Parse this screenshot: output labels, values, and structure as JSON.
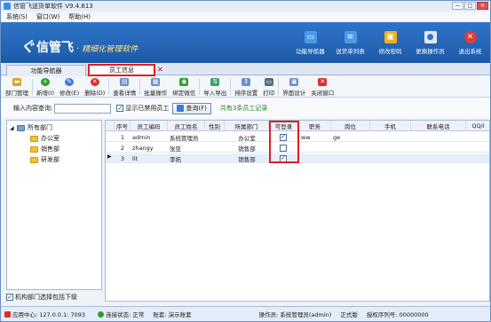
{
  "window": {
    "title": "信管飞送货单软件 V9.4.613",
    "buttons": {
      "min": "—",
      "max": "□",
      "close": "✕"
    }
  },
  "menu": [
    "系统(S)",
    "窗口(W)",
    "帮助(H)"
  ],
  "banner": {
    "brand": "信管飞",
    "slogan": "精细化管理软件",
    "nav": [
      {
        "label": "功能导航器",
        "icon": "monitor-icon",
        "color": "#4a9be8"
      },
      {
        "label": "送货单列表",
        "icon": "list-icon",
        "color": "#4a9be8"
      },
      {
        "label": "修改密码",
        "icon": "lock-icon",
        "color": "#f0b020"
      },
      {
        "label": "更换操作员",
        "icon": "user-icon",
        "color": "#e0e8f0"
      },
      {
        "label": "退出系统",
        "icon": "exit-icon",
        "color": "#e03a3a"
      }
    ]
  },
  "tabs": [
    {
      "label": "功能导航器"
    },
    {
      "label": "员工信息"
    }
  ],
  "toolbar": [
    {
      "label": "部门管理",
      "icon": "folder-icon",
      "color": "#d9a520"
    },
    {
      "label": "新增(I)",
      "icon": "add-icon",
      "color": "#2aa02a"
    },
    {
      "label": "修改(E)",
      "icon": "edit-icon",
      "color": "#3a7bd5"
    },
    {
      "label": "删除(D)",
      "icon": "delete-icon",
      "color": "#d83030"
    },
    {
      "label": "查看详情",
      "icon": "details-icon",
      "color": "#6b8fc8"
    },
    {
      "label": "批量操作",
      "icon": "batch-icon",
      "color": "#6b8fc8"
    },
    {
      "label": "绑定微信",
      "icon": "wechat-icon",
      "color": "#2aa02a"
    },
    {
      "label": "导入导出",
      "icon": "import-export-icon",
      "color": "#3aa06a"
    },
    {
      "label": "排序设置",
      "icon": "sort-icon",
      "color": "#6b8fc8"
    },
    {
      "label": "打印",
      "icon": "print-icon",
      "color": "#5a6a7a"
    },
    {
      "label": "界面设计",
      "icon": "design-icon",
      "color": "#6b8fc8"
    },
    {
      "label": "关闭窗口",
      "icon": "close-window-icon",
      "color": "#d83030"
    }
  ],
  "search": {
    "label": "输入内容查询:",
    "value": "",
    "show_disabled_label": "显示已禁用员工",
    "query_button": "查询(F)",
    "summary": "共有3条员工记录"
  },
  "tree": {
    "root": "所有部门",
    "children": [
      "办公室",
      "销售部",
      "研发部"
    ],
    "include_sub_label": "机构部门选择包括下级"
  },
  "grid": {
    "columns": [
      "序号",
      "员工编码",
      "员工姓名",
      "性别",
      "所属部门",
      "可登录",
      "职务",
      "岗位",
      "手机",
      "联系电话",
      "QQ/I"
    ],
    "rows": [
      {
        "no": "1",
        "code": "admin",
        "name": "系统管理员",
        "gender": "",
        "dept": "办公室",
        "login": true,
        "title": "ww",
        "post": "ge",
        "mobile": "",
        "phone": "",
        "qq": ""
      },
      {
        "no": "2",
        "code": "zhangy",
        "name": "张亚",
        "gender": "",
        "dept": "销售部",
        "login": false,
        "title": "",
        "post": "",
        "mobile": "",
        "phone": "",
        "qq": ""
      },
      {
        "no": "3",
        "code": "lit",
        "name": "李拓",
        "gender": "",
        "dept": "销售部",
        "login": true,
        "title": "",
        "post": "",
        "mobile": "",
        "phone": "",
        "qq": ""
      }
    ]
  },
  "status": {
    "server": "应用中心: 127.0.0.1: 7093",
    "connection": "连接状态: 正常",
    "account": "账套: 演示账套",
    "operator": "操作员: 系统管理员(admin)",
    "edition": "正式版",
    "serial": "授权序列号: 00000000"
  }
}
